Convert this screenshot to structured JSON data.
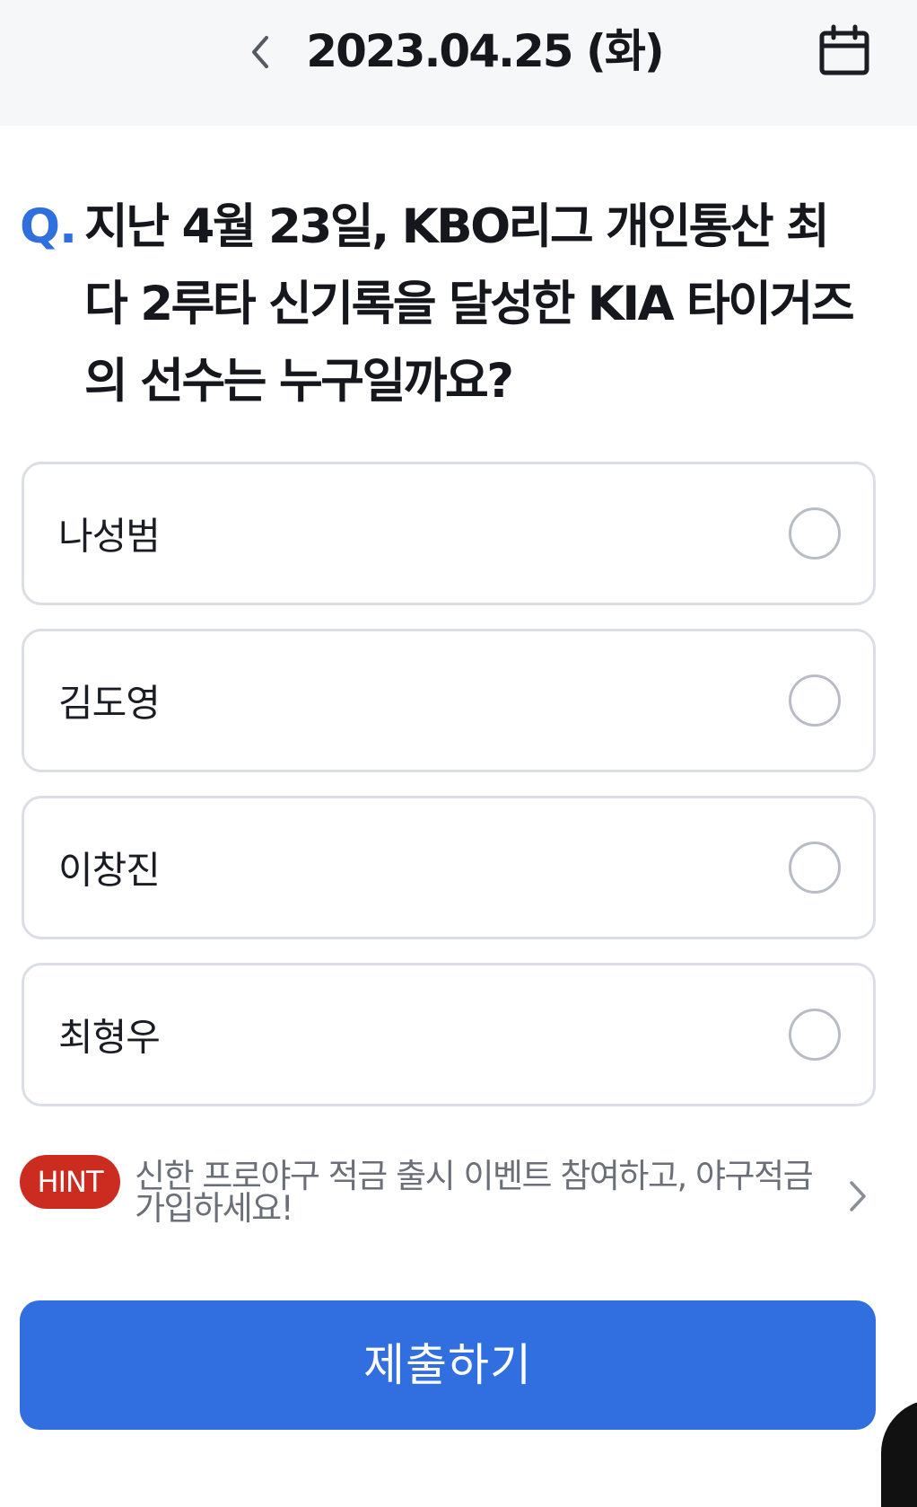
{
  "header": {
    "date": "2023.04.25 (화)",
    "back_icon": "chevron-left-icon",
    "calendar_icon": "calendar-icon"
  },
  "question": {
    "prefix": "Q.",
    "text": "지난 4월 23일, KBO리그 개인통산 최다 2루타 신기록을 달성한 KIA 타이거즈의 선수는 누구일까요?"
  },
  "options": [
    {
      "label": "나성범",
      "selected": false
    },
    {
      "label": "김도영",
      "selected": false
    },
    {
      "label": "이창진",
      "selected": false
    },
    {
      "label": "최형우",
      "selected": false
    }
  ],
  "hint": {
    "badge": "HINT",
    "text": "신한 프로야구 적금 출시 이벤트 참여하고, 야구적금 가입하세요!",
    "chevron_icon": "chevron-right-icon"
  },
  "submit": {
    "label": "제출하기"
  },
  "colors": {
    "accent": "#316ee0",
    "question_mark": "#2f6fde",
    "hint_badge": "#cc2b1f",
    "header_bg": "#f6f7f9",
    "border": "#dcdee3"
  }
}
